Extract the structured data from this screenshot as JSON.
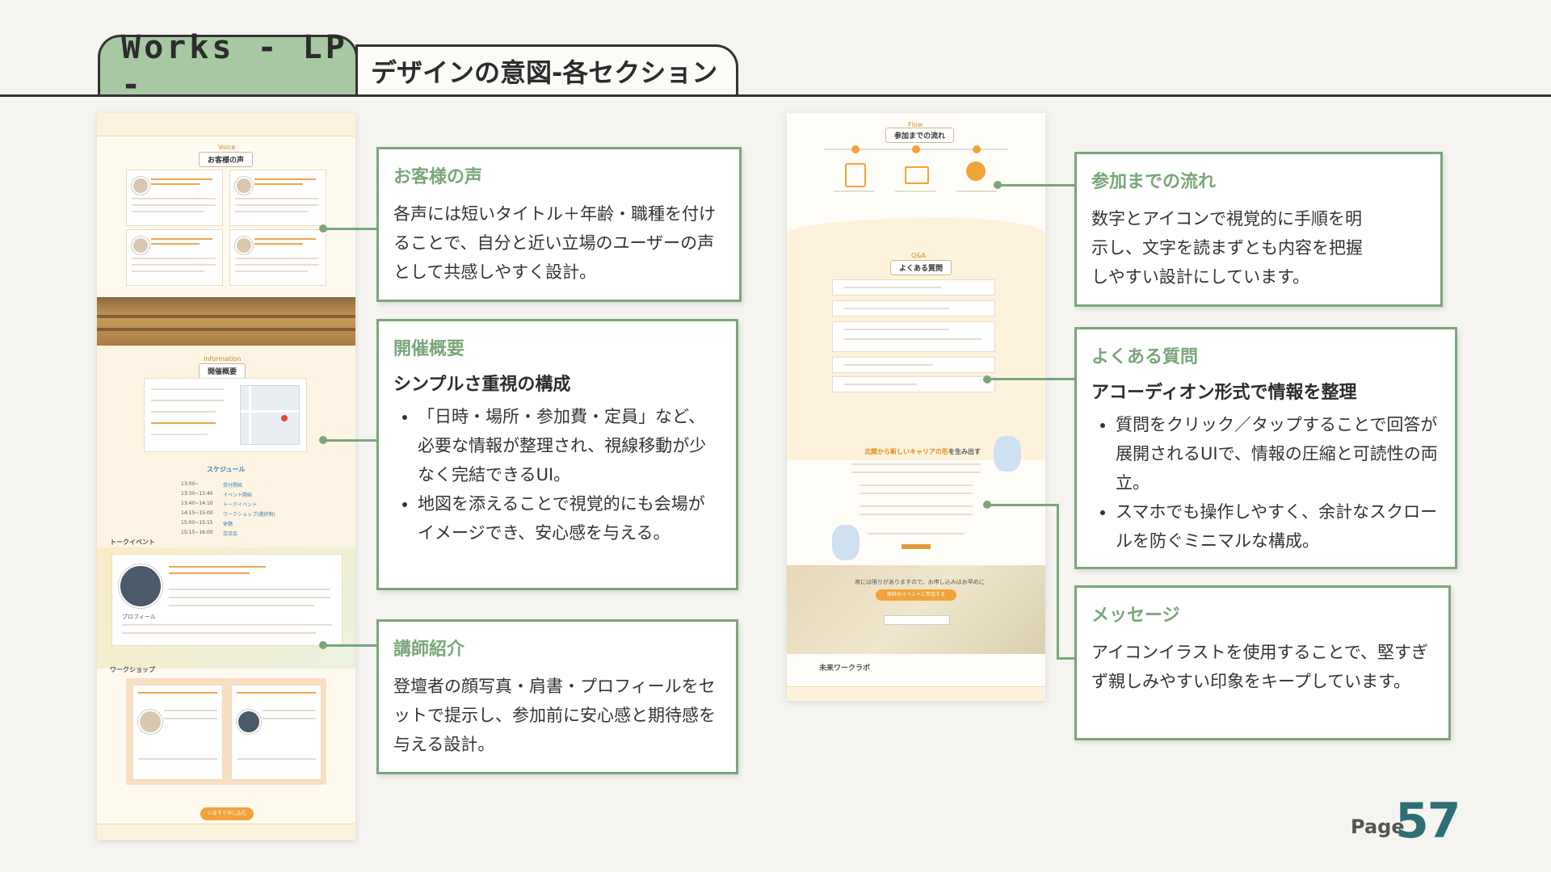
{
  "header": {
    "tab_main": "Works - LP -",
    "tab_sub": "デザインの意図-各セクション"
  },
  "mockup_left": {
    "voices_label": "Voice",
    "voices_title": "お客様の声",
    "summary_label": "Information",
    "summary_title": "開催概要",
    "schedule_title": "スケジュール",
    "schedule": [
      {
        "time": "13:00~",
        "item": "受付開始"
      },
      {
        "time": "13:30~13:40",
        "item": "イベント開始"
      },
      {
        "time": "13:40~14:10",
        "item": "トークイベント"
      },
      {
        "time": "14:15~15:00",
        "item": "ワークショップ(選択制)"
      },
      {
        "time": "15:00~15:15",
        "item": "休憩"
      },
      {
        "time": "15:15~16:00",
        "item": "交流会"
      }
    ],
    "talk_title": "トークイベント",
    "profile_label": "プロフィール",
    "workshop_title": "ワークショップ",
    "cta": "いますぐ申し込む"
  },
  "mockup_right": {
    "flow_label": "Flow",
    "flow_title": "参加までの流れ",
    "faq_label": "Q&A",
    "faq_title": "よくある質問",
    "message_lead_1": "北関から",
    "message_lead_2": "新しいキャリアの形",
    "message_lead_3": "を生み出す",
    "cta_note": "席には限りがありますので、お申し込みはお早めに",
    "cta_button": "無料のイベントに参加する",
    "logo": "未来ワークラボ"
  },
  "boxes": {
    "voices": {
      "title": "お客様の声",
      "body": "各声には短いタイトル＋年齢・職種を付けることで、自分と近い立場のユーザーの声として共感しやすく設計。"
    },
    "summary": {
      "title": "開催概要",
      "lead": "シンプルさ重視の構成",
      "bullets": [
        "「日時・場所・参加費・定員」など、必要な情報が整理され、視線移動が少なく完結できるUI。",
        "地図を添えることで視覚的にも会場がイメージでき、安心感を与える。"
      ]
    },
    "speaker": {
      "title": "講師紹介",
      "body": "登壇者の顔写真・肩書・プロフィールをセットで提示し、参加前に安心感と期待感を与える設計。"
    },
    "flow": {
      "title": "参加までの流れ",
      "body": "数字とアイコンで視覚的に手順を明示し、文字を読まずとも内容を把握しやすい設計にしています。"
    },
    "faq": {
      "title": "よくある質問",
      "lead": "アコーディオン形式で情報を整理",
      "bullets": [
        "質問をクリック／タップすることで回答が展開されるUIで、情報の圧縮と可読性の両立。",
        "スマホでも操作しやすく、余計なスクロールを防ぐミニマルな構成。"
      ]
    },
    "message": {
      "title": "メッセージ",
      "body": "アイコンイラストを使用することで、堅すぎず親しみやすい印象をキープしています。"
    }
  },
  "footer": {
    "page_label": "Page",
    "page_number": "57"
  },
  "colors": {
    "accent_green": "#7aa67a",
    "tab_green": "#a7c8a2",
    "page_teal": "#2d6f73",
    "lp_orange": "#f2a33a"
  }
}
